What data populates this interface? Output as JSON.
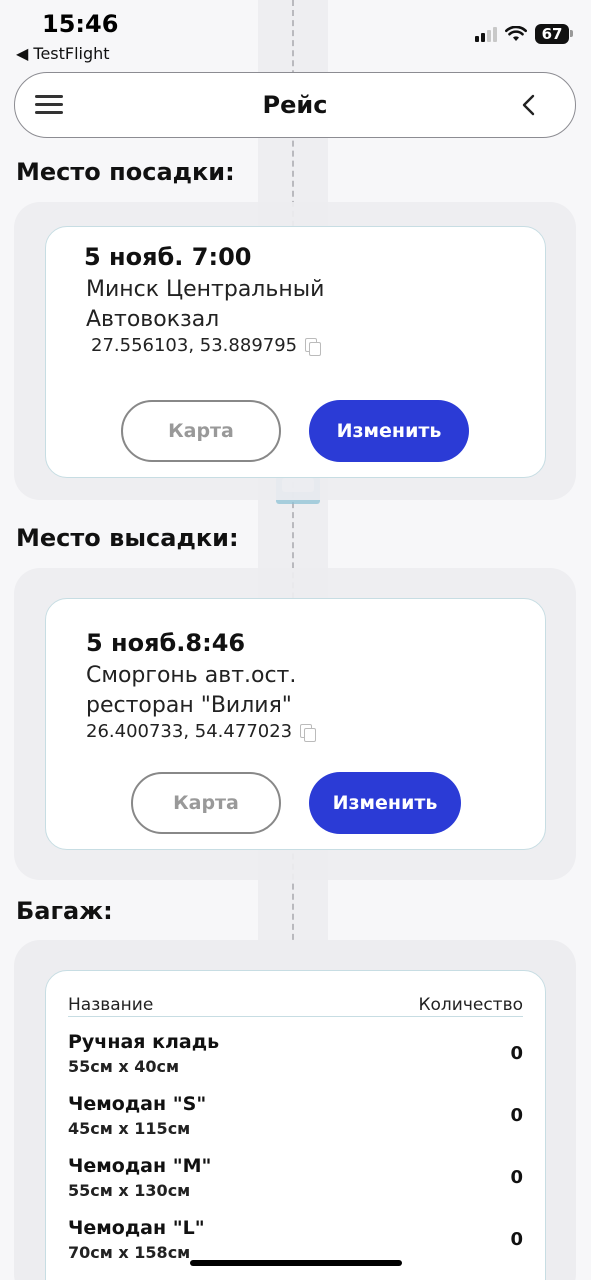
{
  "status_bar": {
    "time": "15:46",
    "back_app": "◀ TestFlight",
    "battery": "67"
  },
  "header": {
    "title": "Рейс"
  },
  "pickup": {
    "section_title": "Место посадки:",
    "datetime": "5 нояб. 7:00",
    "place_line1": "Минск Центральный",
    "place_line2": "Автовокзал",
    "coords": "27.556103, 53.889795",
    "map_label": "Карта",
    "edit_label": "Изменить"
  },
  "dropoff": {
    "section_title": "Место высадки:",
    "datetime": "5 нояб.8:46",
    "place_line1": "Сморгонь авт.ост.",
    "place_line2": "ресторан \"Вилия\"",
    "coords": "26.400733, 54.477023",
    "map_label": "Карта",
    "edit_label": "Изменить"
  },
  "luggage": {
    "section_title": "Багаж:",
    "col_name": "Название",
    "col_qty": "Количество",
    "items": [
      {
        "name": "Ручная кладь",
        "size": "55см х 40см",
        "qty": "0"
      },
      {
        "name": "Чемодан \"S\"",
        "size": "45см х 115см",
        "qty": "0"
      },
      {
        "name": "Чемодан \"M\"",
        "size": "55см х 130см",
        "qty": "0"
      },
      {
        "name": "Чемодан \"L\"",
        "size": "70см х 158см",
        "qty": "0"
      }
    ]
  },
  "colors": {
    "accent": "#2b3bd6",
    "card_border": "#c7dde3",
    "panel": "#ededf0"
  }
}
